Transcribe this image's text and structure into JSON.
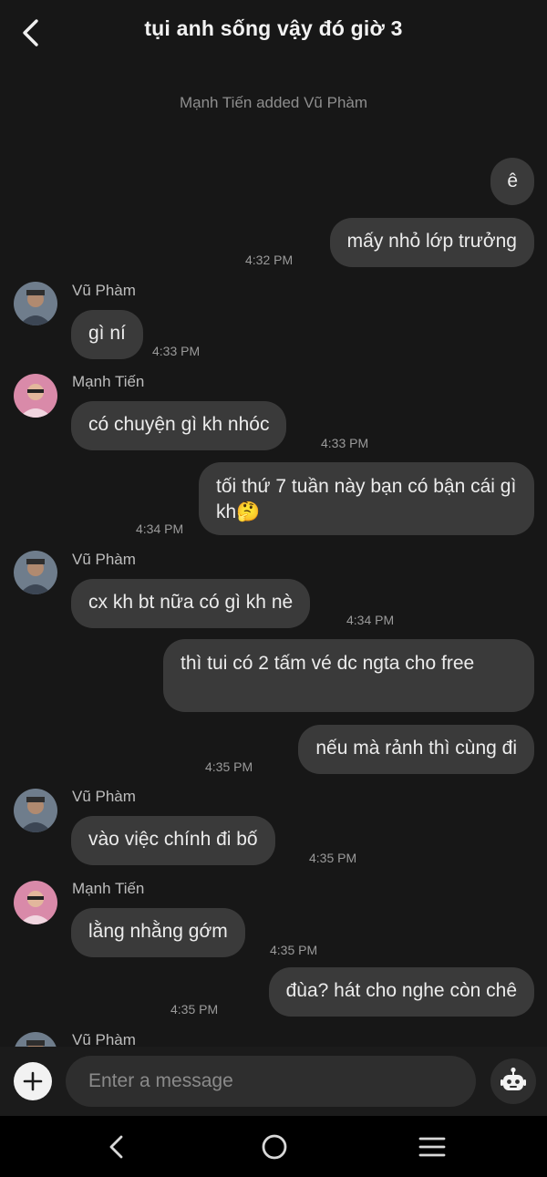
{
  "header": {
    "title": "tụi anh sống vậy đó giờ  3"
  },
  "system_message": "Mạnh Tiến  added Vũ Phàm",
  "messages": [
    {
      "text": "ê"
    },
    {
      "text": "mấy nhỏ lớp trưởng",
      "time": "4:32 PM"
    },
    {
      "sender": "Vũ Phàm",
      "text": "gì ní",
      "time": "4:33 PM"
    },
    {
      "sender": "Mạnh Tiến",
      "text": "có chuyện gì kh nhóc",
      "time": "4:33 PM"
    },
    {
      "text": "tối thứ 7 tuần này bạn có bận cái gì kh🤔",
      "time": "4:34 PM"
    },
    {
      "sender": "Vũ Phàm",
      "text": "cx kh bt nữa có gì kh nè",
      "time": "4:34 PM"
    },
    {
      "text": "thì tui có 2 tấm vé dc ngta cho free"
    },
    {
      "text": "nếu mà rảnh thì cùng đi",
      "time": "4:35 PM"
    },
    {
      "sender": "Vũ Phàm",
      "text": "vào việc chính đi bố",
      "time": "4:35 PM"
    },
    {
      "sender": "Mạnh Tiến",
      "text": "lằng nhằng gớm",
      "time": "4:35 PM"
    },
    {
      "text": "đùa? hát cho nghe còn chê",
      "time": "4:35 PM"
    },
    {
      "sender": "Vũ Phàm"
    }
  ],
  "composer": {
    "placeholder": "Enter a message"
  },
  "icons": {
    "back": "chevron-left-icon",
    "add": "plus-icon",
    "bot": "robot-icon",
    "nav_back": "nav-back-icon",
    "nav_home": "nav-home-icon",
    "nav_recent": "nav-recents-icon"
  },
  "colors": {
    "background": "#171717",
    "bubble": "#3a3a3a",
    "input": "#2e2e2e",
    "navbar": "#000000"
  }
}
